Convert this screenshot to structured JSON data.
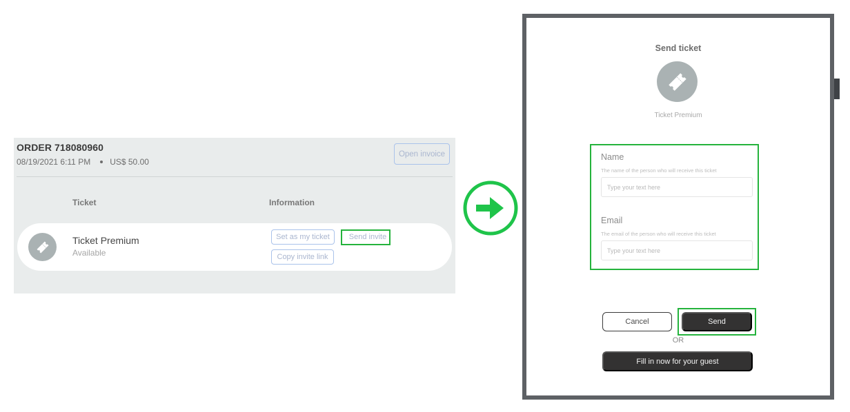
{
  "order": {
    "title": "ORDER 718080960",
    "date": "08/19/2021 6:11 PM",
    "amount": "US$ 50.00",
    "open_invoice_label": "Open invoice",
    "columns": {
      "ticket": "Ticket",
      "information": "Information"
    },
    "ticket": {
      "icon": "ticket-icon",
      "name": "Ticket Premium",
      "status": "Available",
      "actions": {
        "set_my_ticket": "Set as my ticket",
        "send_invite": "Send invite",
        "copy_invite_link": "Copy invite link"
      }
    }
  },
  "arrow": {
    "icon": "arrow-right-circle-icon",
    "color": "#1fc44a"
  },
  "modal": {
    "title": "Send ticket",
    "ticket_icon": "ticket-icon",
    "ticket_name": "Ticket Premium",
    "fields": {
      "name": {
        "label": "Name",
        "hint": "The name of the person who will receive this ticket",
        "placeholder": "Type your text here",
        "value": ""
      },
      "email": {
        "label": "Email",
        "hint": "The email of the person who will receive this ticket",
        "placeholder": "Type your text here",
        "value": ""
      }
    },
    "cancel_label": "Cancel",
    "send_label": "Send",
    "or_label": "OR",
    "fill_in_label": "Fill in now for your guest"
  },
  "colors": {
    "highlight": "#24b33c",
    "primary_dark": "#333232",
    "outline_blue": "#a9c2ea",
    "panel_bg": "#e9ecec",
    "modal_frame": "#5e6165"
  }
}
